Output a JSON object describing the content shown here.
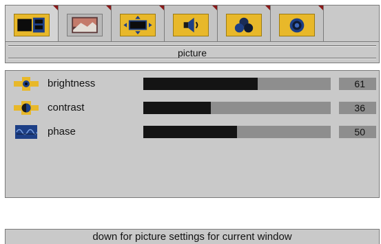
{
  "tabs": [
    {
      "icon": "layout-icon",
      "active": true
    },
    {
      "icon": "picture-icon",
      "active": false
    },
    {
      "icon": "screen-position-icon",
      "active": false
    },
    {
      "icon": "speaker-icon",
      "active": false
    },
    {
      "icon": "color-circles-icon",
      "active": false
    },
    {
      "icon": "signal-icon",
      "active": false
    }
  ],
  "title": "picture",
  "settings": [
    {
      "label": "brightness",
      "value": "61",
      "level": 61,
      "icon": "brightness-icon"
    },
    {
      "label": "contrast",
      "value": "36",
      "level": 36,
      "icon": "contrast-icon"
    },
    {
      "label": "phase",
      "value": "50",
      "level": 50,
      "icon": "phase-icon"
    }
  ],
  "hint": "down for picture settings for current window",
  "colors": {
    "panel": "#c9c9c9",
    "icon_accent": "#e8b82a",
    "track": "#8e8e8e",
    "fill": "#141414",
    "tab_corner": "#8a1a1a"
  }
}
